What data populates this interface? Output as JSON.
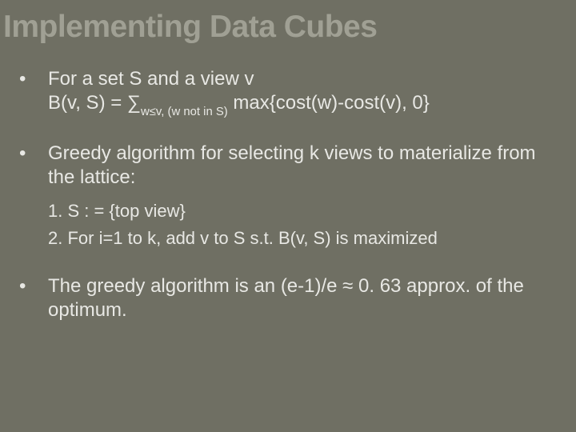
{
  "title": "Implementing Data Cubes",
  "bullets": {
    "b1": {
      "line1": "For a set S and a view v",
      "line2_pre": "B(v, S) = ∑",
      "line2_sub": "w≤v, (w not in S)",
      "line2_post": " max{cost(w)-cost(v), 0}"
    },
    "b2": {
      "text": "Greedy algorithm for selecting k views to materialize from the lattice:",
      "s1": "1.  S : = {top view}",
      "s2": "2.  For i=1 to k, add v to S s.t. B(v, S) is maximized"
    },
    "b3": {
      "text": "The greedy algorithm is an (e-1)/e ≈ 0. 63 approx. of the optimum."
    }
  }
}
